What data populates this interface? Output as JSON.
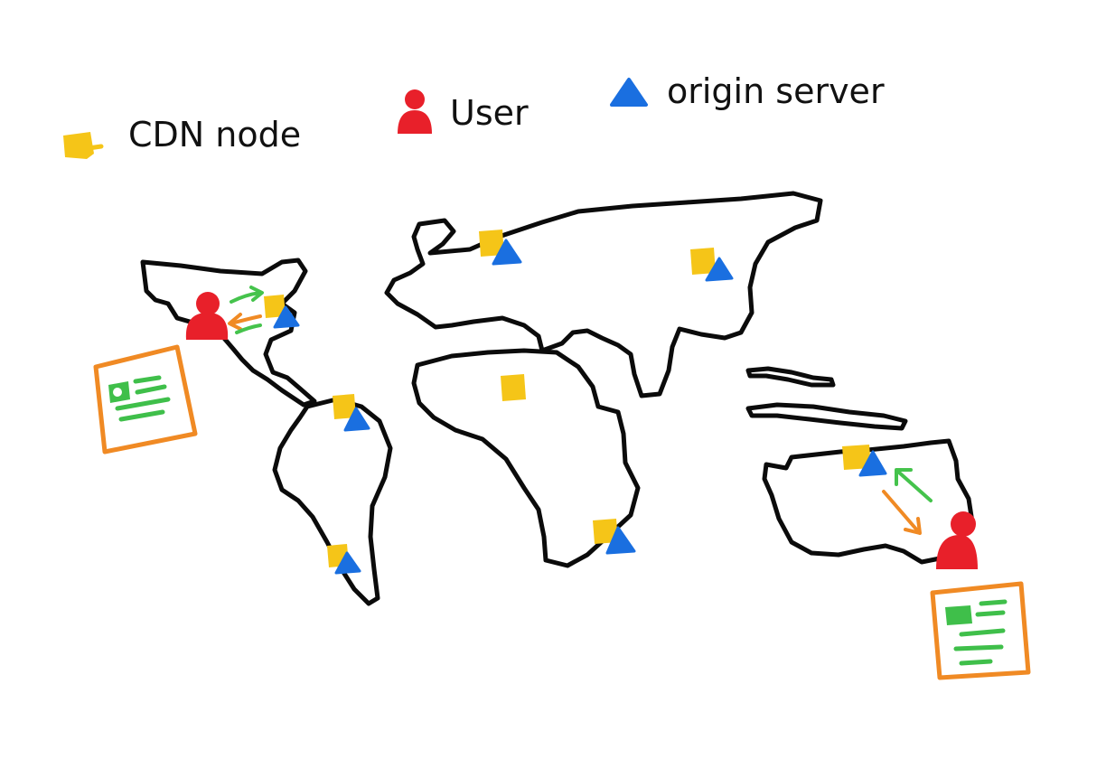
{
  "legend": {
    "cdn_node_label": "CDN node",
    "user_label": "User",
    "origin_server_label": "origin server"
  },
  "colors": {
    "cdn_node": "#f5c518",
    "user": "#e8202a",
    "origin_server": "#1a6fe0",
    "document_frame": "#f08a24",
    "document_lines": "#3fbf4a",
    "response_arrow": "#45c34c",
    "request_arrow": "#f08a24",
    "map_outline": "#0b0b0b"
  },
  "icons": {
    "cdn_node": "yellow-square-icon",
    "user": "person-icon",
    "origin_server": "blue-triangle-icon",
    "document": "document-icon"
  }
}
